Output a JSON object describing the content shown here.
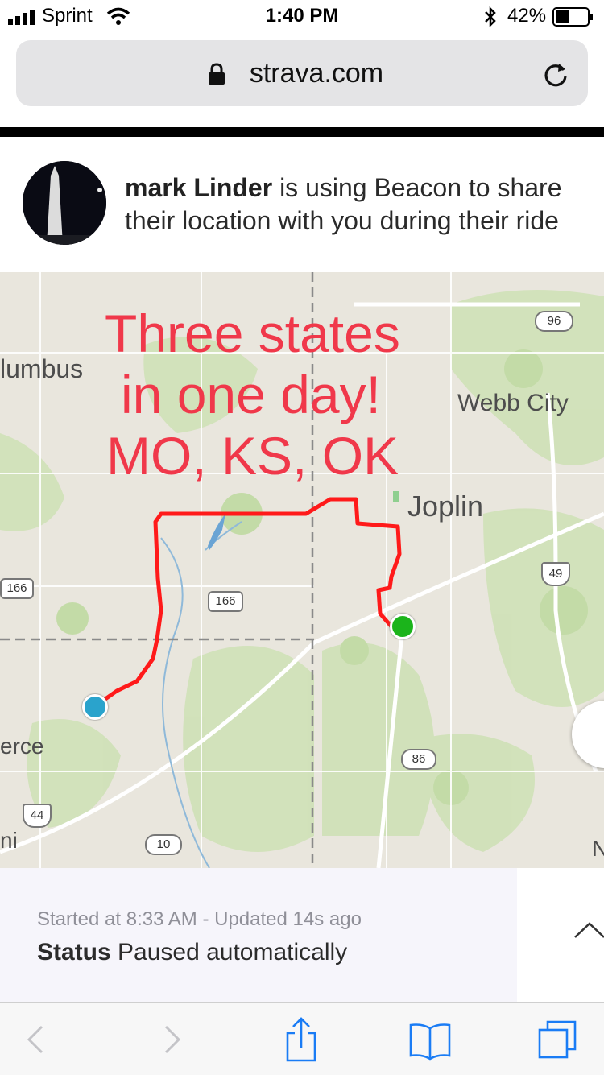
{
  "status_bar": {
    "carrier": "Sprint",
    "time": "1:40 PM",
    "battery": "42%",
    "icons": [
      "signal-bars-icon",
      "wifi-icon",
      "bluetooth-icon",
      "battery-icon"
    ]
  },
  "browser": {
    "url": "strava.com",
    "icons": [
      "lock-icon",
      "reload-icon"
    ]
  },
  "header": {
    "user_name": "mark Linder",
    "message_line1": " is using Beacon to share",
    "message_line2": "their location with you during their ride"
  },
  "map": {
    "places": {
      "columbus": "lumbus",
      "webb_city": "Webb City",
      "joplin": "Joplin",
      "pierce": "erce",
      "edge_left": "ni",
      "edge_right": "N"
    },
    "highway_shields": {
      "h96": "96",
      "h166_left": "166",
      "h166_mid": "166",
      "h49": "49",
      "h86": "86",
      "h44": "44",
      "h10": "10"
    },
    "annotation": [
      "Three states",
      "in one day!",
      "MO, KS, OK"
    ],
    "colors": {
      "route": "#ff1a1a",
      "start_marker": "#2aa3cc",
      "current_marker": "#1bb41b",
      "annotation": "#f0384a"
    }
  },
  "activity": {
    "started": "Started at 8:33 AM - Updated 14s ago",
    "status_label": "Status",
    "status_value": " Paused automatically"
  },
  "toolbar": {
    "icons": [
      "back-icon",
      "forward-icon",
      "share-icon",
      "bookmarks-icon",
      "tabs-icon"
    ]
  }
}
